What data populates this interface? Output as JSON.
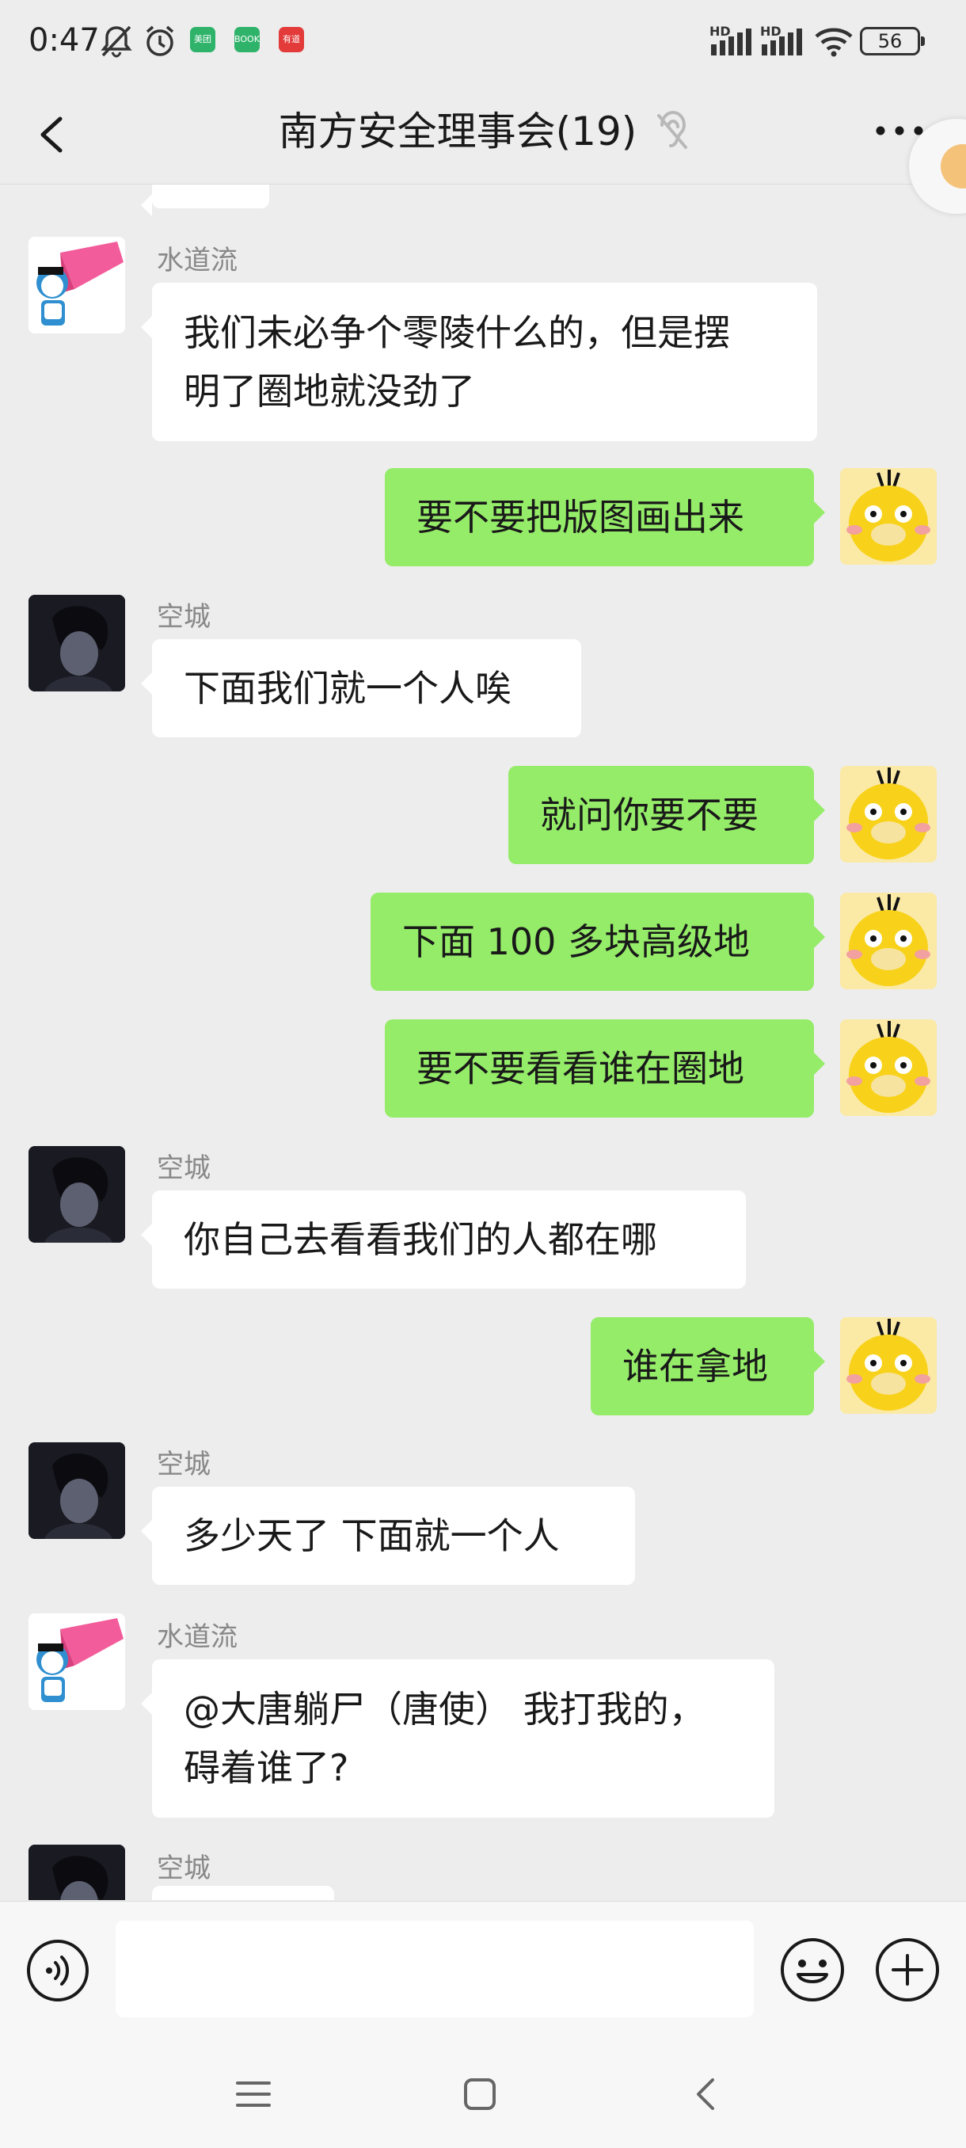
{
  "status_bar": {
    "time": "0:47",
    "app_badges": [
      "美团",
      "BOOK",
      "有道"
    ],
    "signal_labels": [
      "HD",
      "HD"
    ],
    "battery": "56"
  },
  "header": {
    "title": "南方安全理事会(19)",
    "back_icon": "chevron-left-icon",
    "mute_icon": "ear-off-icon",
    "more_icon": "more-dots-icon"
  },
  "messages": [
    {
      "side": "in",
      "sender": "水道流",
      "text_lines": [
        "我们未必争个零陵什么的，但是摆",
        "明了圈地就没劲了"
      ]
    },
    {
      "side": "out",
      "text_lines": [
        "要不要把版图画出来"
      ]
    },
    {
      "side": "in",
      "sender": "空城",
      "text_lines": [
        "下面我们就一个人唉"
      ]
    },
    {
      "side": "out",
      "text_lines": [
        "就问你要不要"
      ]
    },
    {
      "side": "out",
      "text_lines": [
        "下面 100 多块高级地"
      ]
    },
    {
      "side": "out",
      "text_lines": [
        "要不要看看谁在圈地"
      ]
    },
    {
      "side": "in",
      "sender": "空城",
      "text_lines": [
        "你自己去看看我们的人都在哪"
      ]
    },
    {
      "side": "out",
      "text_lines": [
        "谁在拿地"
      ]
    },
    {
      "side": "in",
      "sender": "空城",
      "text_lines": [
        "多少天了 下面就一个人"
      ]
    },
    {
      "side": "in",
      "sender": "水道流",
      "text_lines": [
        "@大唐躺尸（唐使） 我打我的，",
        "碍着谁了?"
      ]
    },
    {
      "side": "in",
      "sender": "空城",
      "text_lines": []
    }
  ],
  "input_bar": {
    "voice_icon": "voice-icon",
    "text_value": "",
    "emoji_icon": "emoji-icon",
    "plus_icon": "plus-icon"
  },
  "nav_bar": {
    "menu_icon": "menu-icon",
    "home_icon": "home-square-icon",
    "back_icon": "back-triangle-icon"
  }
}
